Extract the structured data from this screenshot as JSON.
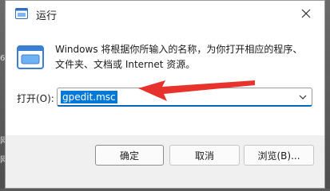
{
  "background": {
    "left_edge_chars": [
      "6",
      "网",
      "网"
    ]
  },
  "dialog": {
    "title": "运行",
    "description": "Windows 将根据你所输入的名称，为你打开相应的程序、文件夹、文档或 Internet 资源。",
    "open_label": "打开(O):",
    "command_value": "gpedit.msc",
    "buttons": {
      "ok": "确定",
      "cancel": "取消",
      "browse": "浏览(B)..."
    }
  },
  "icons": {
    "title_icon": "run-icon",
    "big_icon": "run-icon",
    "close": "close-icon",
    "dropdown": "chevron-down-icon",
    "annotation": "red-arrow-icon"
  },
  "colors": {
    "selection": "#0078d7",
    "annotation_arrow": "#e8332c",
    "accent_border": "#0067c0"
  }
}
